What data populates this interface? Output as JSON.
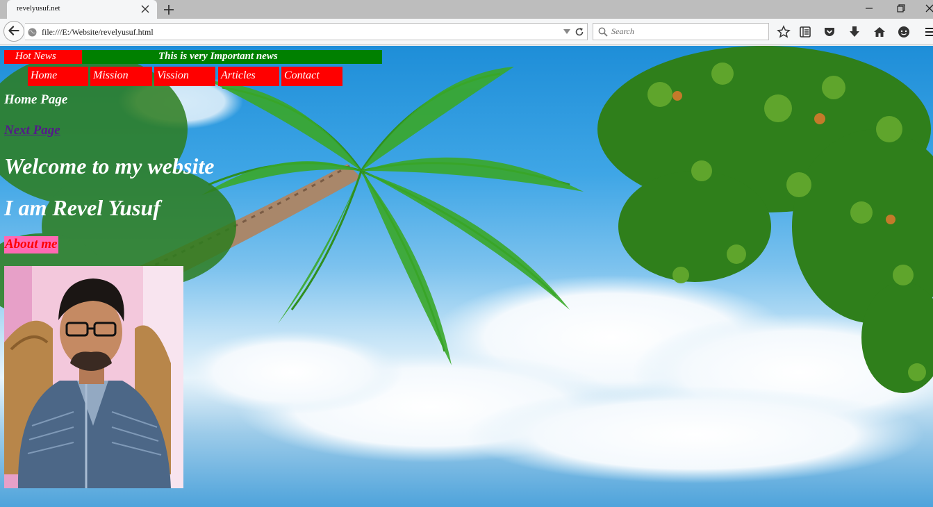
{
  "browser": {
    "tab_title": "revelyusuf.net",
    "url": "file:///E:/Website/revelyusuf.html",
    "search_placeholder": "Search"
  },
  "page": {
    "hot_news_label": "Hot News",
    "news_ticker": "This is very  Important news",
    "nav": [
      "Home",
      "Mission",
      "Vission",
      "Articles",
      "Contact"
    ],
    "heading": "Home Page",
    "next_link": "Next Page",
    "welcome": "Welcome to my website",
    "name_line": "I am Revel Yusuf",
    "about_label": "About me"
  },
  "colors": {
    "hot_news_bg": "#ff0000",
    "ticker_bg": "#008000",
    "nav_bg": "#ff0000",
    "about_bg": "#ff69b4",
    "about_text": "#ff0000",
    "link": "#551a8b"
  }
}
